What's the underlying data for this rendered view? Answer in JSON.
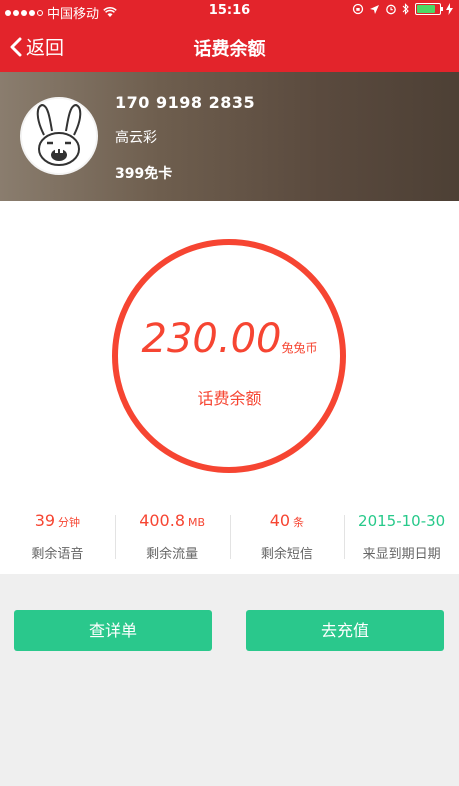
{
  "status_bar": {
    "carrier": "中国移动",
    "time": "15:16"
  },
  "nav": {
    "back_label": "返回",
    "title": "话费余额"
  },
  "profile": {
    "phone": "170 9198 2835",
    "name": "高云彩",
    "plan": "399免卡"
  },
  "balance": {
    "amount": "230.00",
    "unit": "兔兔币",
    "label": "话费余额"
  },
  "stats": [
    {
      "value": "39",
      "unit": "分钟",
      "label": "剩余语音"
    },
    {
      "value": "400.8",
      "unit": "MB",
      "label": "剩余流量"
    },
    {
      "value": "40",
      "unit": "条",
      "label": "剩余短信"
    },
    {
      "value": "2015-10-30",
      "unit": "",
      "label": "来显到期日期"
    }
  ],
  "buttons": {
    "detail": "查详单",
    "recharge": "去充值"
  },
  "colors": {
    "header": "#e3242b",
    "accent_red": "#f64532",
    "accent_green": "#2ac88c"
  }
}
